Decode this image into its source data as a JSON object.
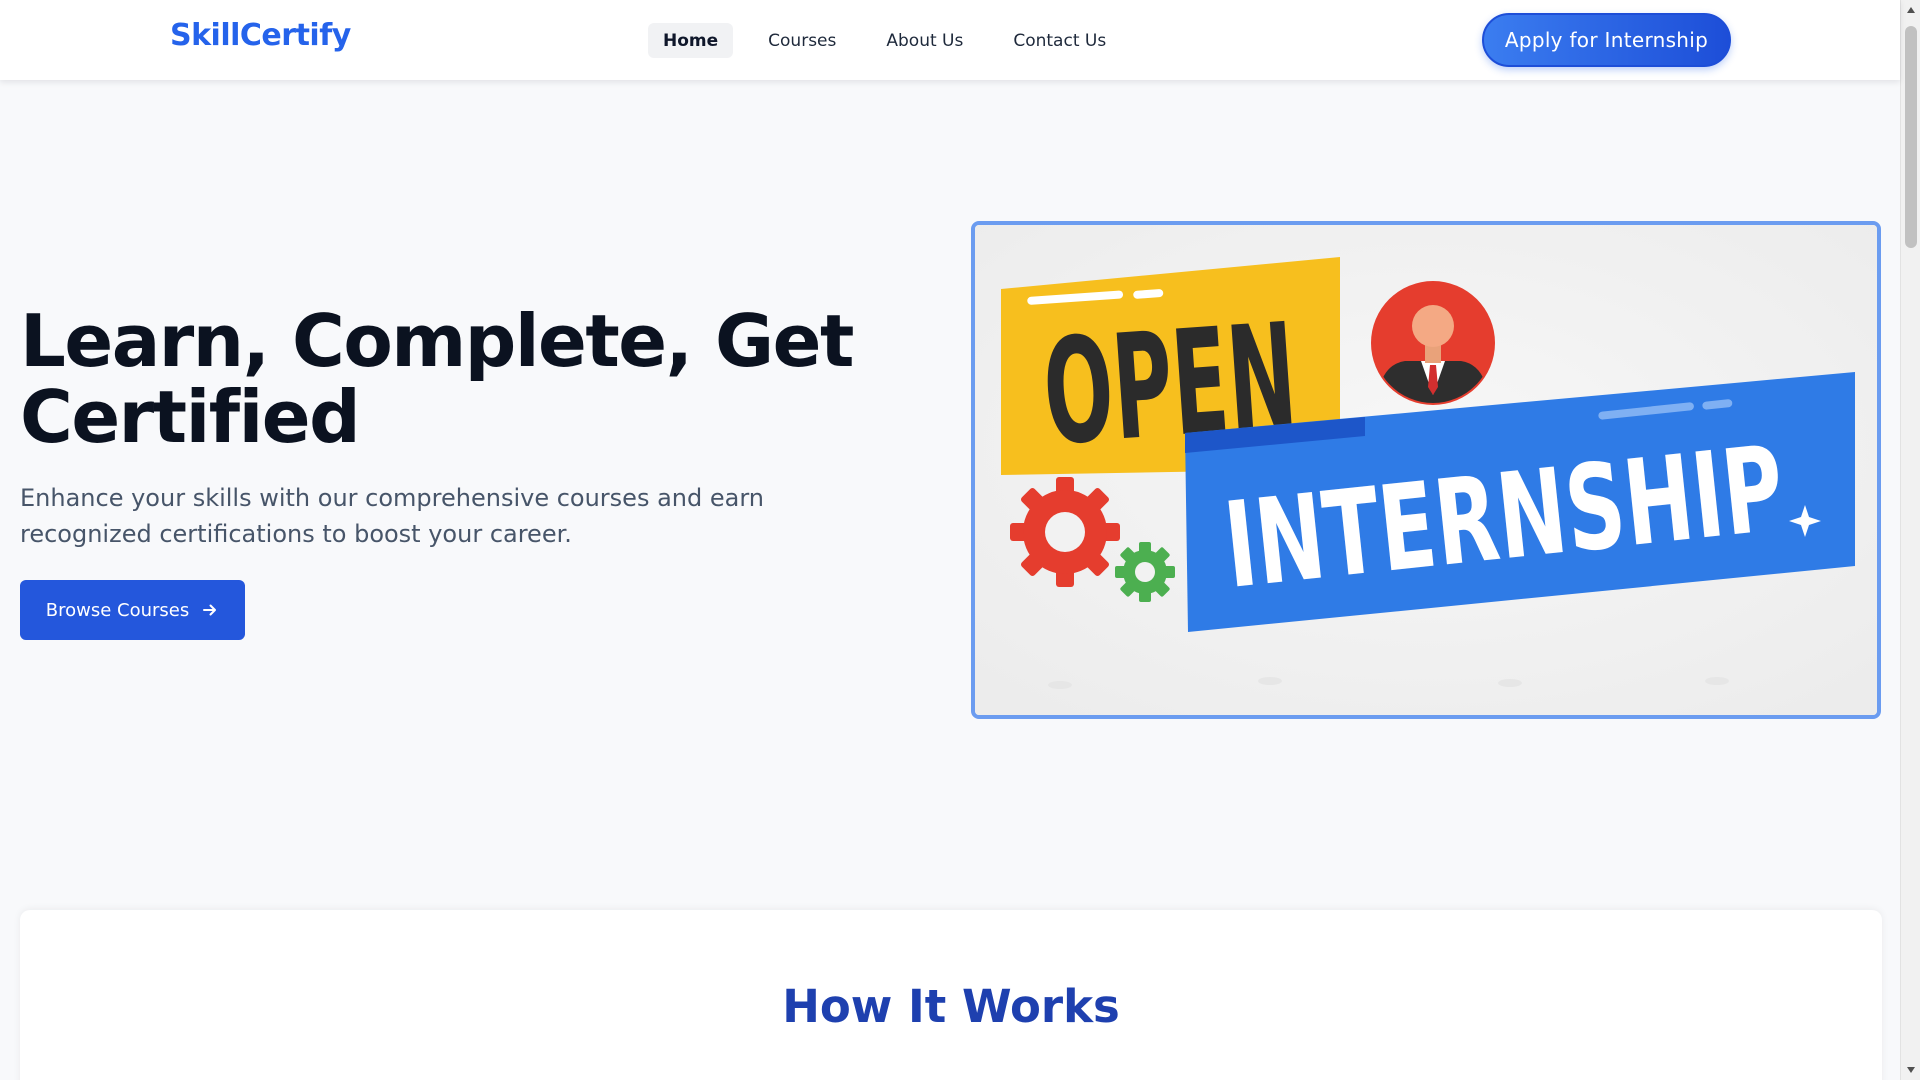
{
  "header": {
    "logo": "SkillCertify",
    "nav": [
      {
        "label": "Home",
        "active": true
      },
      {
        "label": "Courses",
        "active": false
      },
      {
        "label": "About Us",
        "active": false
      },
      {
        "label": "Contact Us",
        "active": false
      }
    ],
    "cta_label": "Apply for Internship"
  },
  "hero": {
    "title": "Learn, Complete, Get Certified",
    "subtitle": "Enhance your skills with our comprehensive courses and earn recognized certifications to boost your career.",
    "button_label": "Browse Courses",
    "button_icon": "arrow-right-icon",
    "image": {
      "word_top": "OPEN",
      "word_bottom": "INTERNSHIP",
      "icons": [
        "user-avatar-icon",
        "red-gear-icon",
        "green-gear-icon",
        "sparkle-icon"
      ],
      "colors": {
        "yellow": "#f7bf1e",
        "blue": "#2f7be6",
        "red": "#e53d2e",
        "green": "#4caf50"
      }
    }
  },
  "how_it_works": {
    "title": "How It Works"
  },
  "colors": {
    "brand": "#2563eb",
    "heading_blue": "#1e40af",
    "background": "#f8f9fb"
  }
}
